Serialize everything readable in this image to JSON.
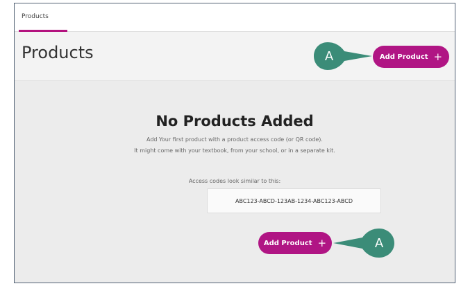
{
  "tabs": [
    {
      "label": "Products",
      "active": true
    }
  ],
  "header": {
    "title": "Products",
    "add_button_label": "Add Product",
    "add_button_icon": "plus-icon"
  },
  "empty_state": {
    "title": "No Products Added",
    "line1": "Add Your first product with a product access code (or QR code).",
    "line2": "It might come with your textbook, from your school, or in a separate kit.",
    "code_hint": "Access codes look similar to this:",
    "sample_code": "ABC123-ABCD-123AB-1234-ABC123-ABCD",
    "add_button_label": "Add Product"
  },
  "callouts": {
    "top": "A",
    "bottom": "A"
  },
  "colors": {
    "brand": "#b01584",
    "callout": "#3b8c78",
    "frame": "#4f5f72"
  }
}
